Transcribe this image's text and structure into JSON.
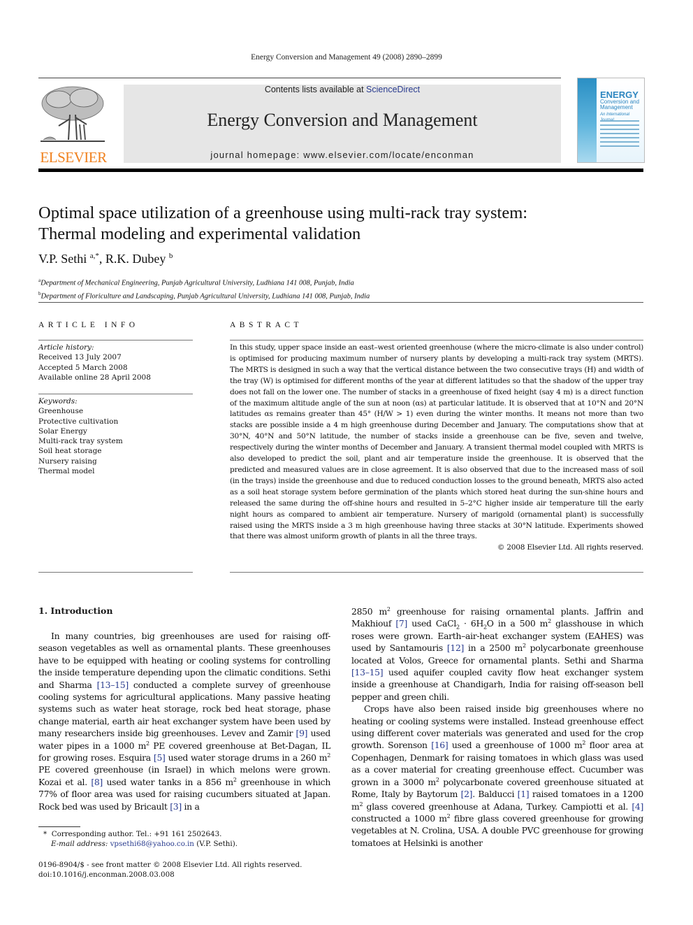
{
  "running_head": "Energy Conversion and Management 49 (2008) 2890–2899",
  "banner": {
    "contents_prefix": "Contents lists available at ",
    "contents_link": "ScienceDirect",
    "journal_name": "Energy Conversion and Management",
    "homepage": "journal homepage: www.elsevier.com/locate/enconman"
  },
  "publisher_logo": {
    "wordmark": "ELSEVIER",
    "color": "#f0811e"
  },
  "cover": {
    "title_line1": "ENERGY",
    "title_line2": "Conversion and",
    "title_line3": "Management",
    "subtitle": "An International Journal"
  },
  "article": {
    "title_line1": "Optimal space utilization of a greenhouse using multi-rack tray system:",
    "title_line2": "Thermal modeling and experimental validation",
    "authors": [
      {
        "name": "V.P. Sethi",
        "sup": "a,*"
      },
      {
        "name": "R.K. Dubey",
        "sup": "b"
      }
    ],
    "author_separator": ", ",
    "affiliations": [
      {
        "mark": "a",
        "text": "Department of Mechanical Engineering, Punjab Agricultural University, Ludhiana 141 008, Punjab, India"
      },
      {
        "mark": "b",
        "text": "Department of Floriculture and Landscaping, Punjab Agricultural University, Ludhiana 141 008, Punjab, India"
      }
    ]
  },
  "article_info": {
    "heading": "ARTICLE INFO",
    "history_label": "Article history:",
    "history": [
      "Received 13 July 2007",
      "Accepted 5 March 2008",
      "Available online 28 April 2008"
    ],
    "keywords_label": "Keywords:",
    "keywords": [
      "Greenhouse",
      "Protective cultivation",
      "Solar Energy",
      "Multi-rack tray system",
      "Soil heat storage",
      "Nursery raising",
      "Thermal model"
    ]
  },
  "abstract": {
    "heading": "ABSTRACT",
    "text": "In this study, upper space inside an east–west oriented greenhouse (where the micro-climate is also under control) is optimised for producing maximum number of nursery plants by developing a multi-rack tray system (MRTS). The MRTS is designed in such a way that the vertical distance between the two consecutive trays (H) and width of the tray (W) is optimised for different months of the year at different latitudes so that the shadow of the upper tray does not fall on the lower one. The number of stacks in a greenhouse of fixed height (say 4 m) is a direct function of the maximum altitude angle of the sun at noon (αs) at particular latitude. It is observed that at 10°N and 20°N latitudes αs remains greater than 45° (H/W > 1) even during the winter months. It means not more than two stacks are possible inside a 4 m high greenhouse during December and January. The computations show that at 30°N, 40°N and 50°N latitude, the number of stacks inside a greenhouse can be five, seven and twelve, respectively during the winter months of December and January. A transient thermal model coupled with MRTS is also developed to predict the soil, plant and air temperature inside the greenhouse. It is observed that the predicted and measured values are in close agreement. It is also observed that due to the increased mass of soil (in the trays) inside the greenhouse and due to reduced conduction losses to the ground beneath, MRTS also acted as a soil heat storage system before germination of the plants which stored heat during the sun-shine hours and released the same during the off-shine hours and resulted in 5–2°C higher inside air temperature till the early night hours as compared to ambient air temperature. Nursery of marigold (ornamental plant) is successfully raised using the MRTS inside a 3 m high greenhouse having three stacks at 30°N latitude. Experiments showed that there was almost uniform growth of plants in all the three trays.",
    "copyright": "© 2008 Elsevier Ltd. All rights reserved."
  },
  "introduction": {
    "heading": "1.  Introduction",
    "left_col": {
      "t1": "In many countries, big greenhouses are used for raising off-season vegetables as well as ornamental plants. These greenhouses have to be equipped with heating or cooling systems for controlling the inside temperature depending upon the climatic conditions. Sethi and Sharma ",
      "r1": "[13–15]",
      "t2": " conducted a complete survey of greenhouse cooling systems for agricultural applications. Many passive heating systems such as water heat storage, rock bed heat storage, phase change material, earth air heat exchanger system have been used by many researchers inside big greenhouses. Levev and Zamir ",
      "r2": "[9]",
      "t3": " used water pipes in a 1000 m",
      "t4": " PE covered greenhouse at Bet-Dagan, IL for growing roses. Esquira ",
      "r3": "[5]",
      "t5": " used water storage drums in a 260 m",
      "t6": " PE covered greenhouse (in Israel) in which melons were grown. Kozai et al. ",
      "r4": "[8]",
      "t7": " used water tanks in a 856 m",
      "t8": " greenhouse in which 77% of floor area was used for raising cucumbers situated at Japan. Rock bed was used by Bricault ",
      "r5": "[3]",
      "t9": " in a"
    },
    "right_col": {
      "p1_t1": "2850 m",
      "p1_t2": " greenhouse for raising ornamental plants. Jaffrin and Makhiouf ",
      "p1_r1": "[7]",
      "p1_t3": " used CaCl",
      "p1_t4": " · 6H",
      "p1_t5": "O in a 500 m",
      "p1_t6": " glasshouse in which roses were grown. Earth–air-heat exchanger system (EAHES) was used by Santamouris ",
      "p1_r2": "[12]",
      "p1_t7": " in a 2500 m",
      "p1_t8": " polycarbonate greenhouse located at Volos, Greece for ornamental plants. Sethi and Sharma ",
      "p1_r3": "[13–15]",
      "p1_t9": " used aquifer coupled cavity flow heat exchanger system inside a greenhouse at Chandigarh, India for raising off-season bell pepper and green chili.",
      "p2_t1": "Crops have also been raised inside big greenhouses where no heating or cooling systems were installed. Instead greenhouse effect using different cover materials was generated and used for the crop growth. Sorenson ",
      "p2_r1": "[16]",
      "p2_t2": " used a greenhouse of 1000 m",
      "p2_t3": " floor area at Copenhagen, Denmark for raising tomatoes in which glass was used as a cover material for creating greenhouse effect. Cucumber was grown in a 3000 m",
      "p2_t4": " polycarbonate covered greenhouse situated at Rome, Italy by Baytorum ",
      "p2_r2": "[2]",
      "p2_t5": ". Balducci ",
      "p2_r3": "[1]",
      "p2_t6": " raised tomatoes in a 1200 m",
      "p2_t7": " glass covered greenhouse at Adana, Turkey. Campiotti et al. ",
      "p2_r4": "[4]",
      "p2_t8": " constructed a 1000 m",
      "p2_t9": " fibre glass covered greenhouse for growing vegetables at N. Crolina, USA. A double PVC greenhouse for growing tomatoes at Helsinki is another",
      "sup2": "2",
      "sub2": "2"
    }
  },
  "footnote": {
    "star": "*",
    "corr": "Corresponding author. Tel.: +91 161 2502643.",
    "email_label": "E-mail address: ",
    "email": "vpsethi68@yahoo.co.in",
    "email_suffix": " (V.P. Sethi)."
  },
  "issn_line": "0196-8904/$ - see front matter © 2008 Elsevier Ltd. All rights reserved.",
  "doi": "doi:10.1016/j.enconman.2008.03.008",
  "colors": {
    "link": "#2a3c8f",
    "elsevier_orange": "#f0811e",
    "banner_bg": "#e6e6e6"
  }
}
